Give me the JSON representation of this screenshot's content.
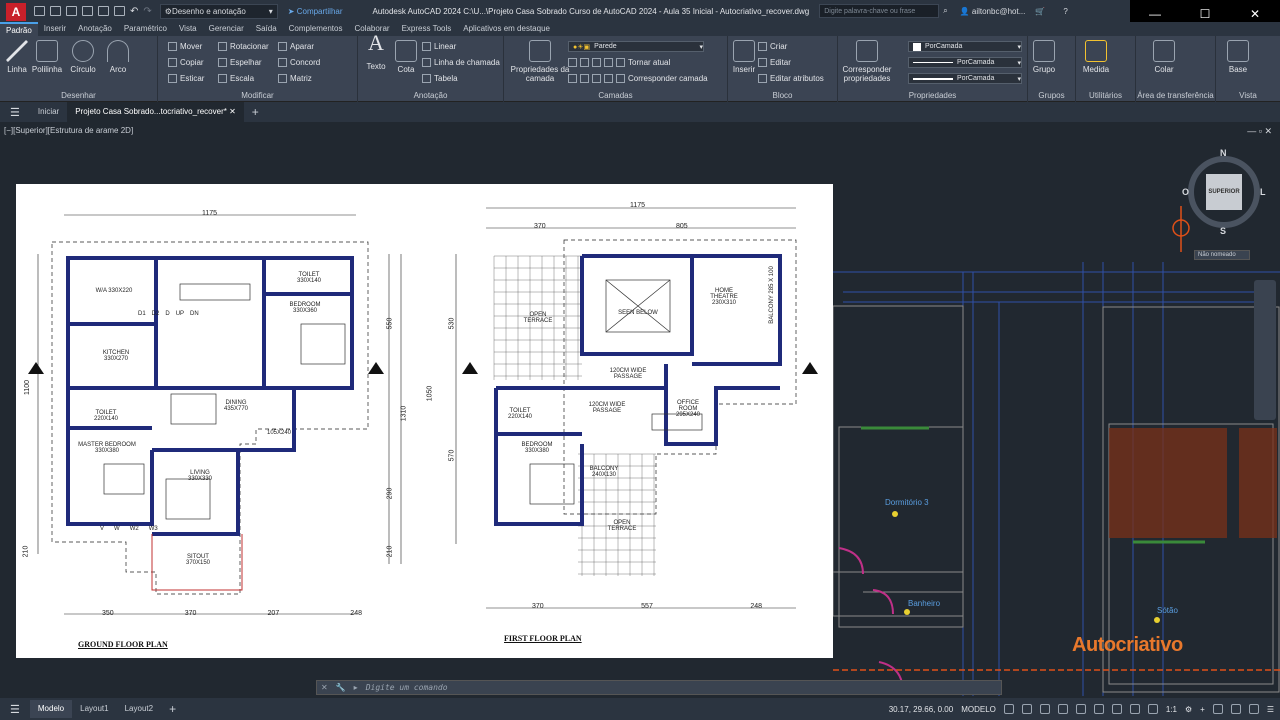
{
  "titlebar": {
    "app_letter": "A",
    "workspace": "Desenho e anotação",
    "share": "Compartilhar",
    "title": "Autodesk AutoCAD 2024    C:\\U...\\Projeto Casa Sobrado Curso de AutoCAD 2024 - Aula 35 Inicial - Autocriativo_recover.dwg",
    "search_placeholder": "Digite palavra-chave ou frase",
    "user": "ailtonbc@hot...",
    "min": "—",
    "max": "☐",
    "close": "✕"
  },
  "ribbon_tabs": [
    "Padrão",
    "Inserir",
    "Anotação",
    "Paramétrico",
    "Vista",
    "Gerenciar",
    "Saída",
    "Complementos",
    "Colaborar",
    "Express Tools",
    "Aplicativos em destaque"
  ],
  "ribbon": {
    "desenhar": {
      "title": "Desenhar",
      "linha": "Linha",
      "polilinha": "Polilinha",
      "circulo": "Círculo",
      "arco": "Arco"
    },
    "modificar": {
      "title": "Modificar",
      "mover": "Mover",
      "rotacionar": "Rotacionar",
      "aparar": "Aparar",
      "copiar": "Copiar",
      "espelhar": "Espelhar",
      "concord": "Concord",
      "esticar": "Esticar",
      "escala": "Escala",
      "matriz": "Matriz"
    },
    "anotacao": {
      "title": "Anotação",
      "texto": "Texto",
      "cota": "Cota",
      "linear": "Linear",
      "linha_chamada": "Linha de chamada",
      "tabela": "Tabela"
    },
    "camadas": {
      "title": "Camadas",
      "propriedades": "Propriedades da camada",
      "layer": "Parede",
      "tornar_atual": "Tornar atual",
      "corresponder": "Corresponder camada"
    },
    "bloco": {
      "title": "Bloco",
      "inserir": "Inserir",
      "criar": "Criar",
      "editar": "Editar",
      "editar_atributos": "Editar atributos"
    },
    "propriedades": {
      "title": "Propriedades",
      "corresponder": "Corresponder propriedades",
      "cor": "PorCamada",
      "linha1": "PorCamada",
      "linha2": "PorCamada"
    },
    "grupos": {
      "title": "Grupos",
      "grupo": "Grupo"
    },
    "utilitarios": {
      "title": "Utilitários",
      "medida": "Medida"
    },
    "transferencia": {
      "title": "Área de transferência",
      "colar": "Colar"
    },
    "vista": {
      "title": "Vista",
      "base": "Base"
    }
  },
  "doc_tabs": {
    "inicio": "Iniciar",
    "doc": "Projeto Casa Sobrado...tocriativo_recover*",
    "plus": "+"
  },
  "viewport_label": "[−][Superior][Estrutura de arame 2D]",
  "viewcube": {
    "n": "N",
    "s": "S",
    "e": "L",
    "w": "O",
    "face": "SUPERIOR",
    "unnamed": "Não nomeado"
  },
  "plan": {
    "ground_title": "GROUND FLOOR PLAN",
    "first_title": "FIRST FLOOR PLAN",
    "ground_top": "1175",
    "first_top": "1175",
    "first_top2": "370",
    "first_top3": "805",
    "ground_bottom": [
      "350",
      "370",
      "207",
      "248"
    ],
    "first_bottom": [
      "370",
      "557",
      "248"
    ],
    "ground_left": [
      "1100",
      "210"
    ],
    "ground_right": [
      "550",
      "1310",
      "290",
      "210"
    ],
    "first_left": [
      "530",
      "1050",
      "570"
    ],
    "rooms_ground": [
      "W/A 330X220",
      "KITCHEN 330X270",
      "TOILET 330X140",
      "BEDROOM 330X360",
      "DINING 435X770",
      "TOILET 220X140",
      "MASTER BEDROOM 330X380",
      "LIVING 330X330",
      "SITOUT 370X150",
      "105X240"
    ],
    "rooms_first": [
      "OPEN TERRACE",
      "SEEN BELOW",
      "HOME THEATRE 230X310",
      "BALCONY 285 X 100",
      "120CM WIDE PASSAGE",
      "TOILET 220X140",
      "120CM WIDE PASSAGE",
      "OFFICE ROOM 295X240",
      "BEDROOM 330X380",
      "BALCONY 240X130",
      "OPEN TERRACE"
    ],
    "door_labels": [
      "D1",
      "D2",
      "D",
      "UP",
      "DN",
      "V",
      "W",
      "W2",
      "W3"
    ]
  },
  "cad_right": {
    "dormitorio": "Dormitório 3",
    "banheiro": "Banheiro",
    "sotao": "Sótão"
  },
  "brand": "Autocriativo",
  "command_placeholder": "Digite um comando",
  "layout_tabs": [
    "Modelo",
    "Layout1",
    "Layout2",
    "+"
  ],
  "status": {
    "coords": "30.17, 29.66, 0.00",
    "mode": "MODELO",
    "scale": "1:1"
  }
}
